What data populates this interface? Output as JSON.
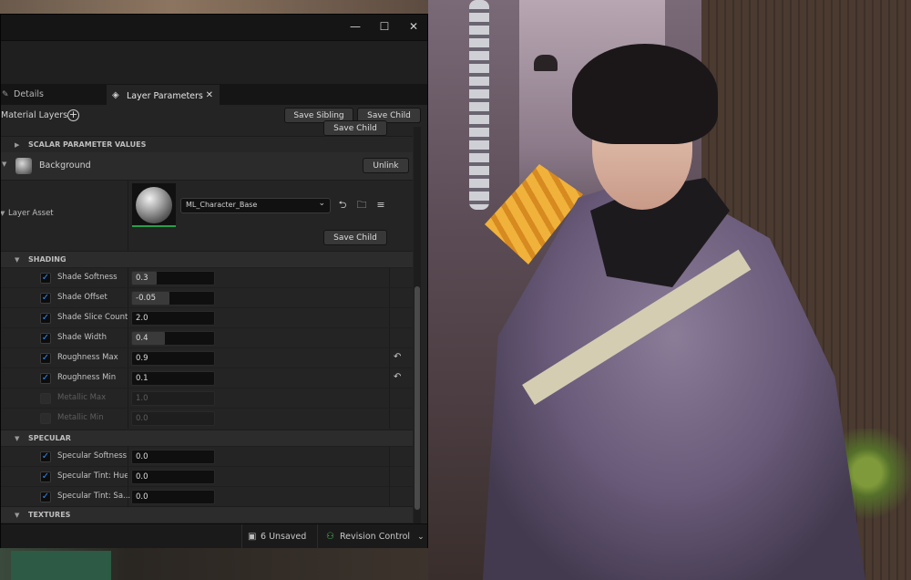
{
  "window": {
    "controls": {
      "minimize": "—",
      "maximize": "☐",
      "close": "✕"
    }
  },
  "tabs": [
    {
      "label": "Details",
      "icon": "pencil-icon"
    },
    {
      "label": "Layer Parameters",
      "icon": "layers-icon",
      "close": "✕"
    }
  ],
  "header": {
    "title": "Material Layers",
    "add_icon": "+",
    "save_sibling": "Save Sibling",
    "save_child": "Save Child"
  },
  "clipped_button": "Save Child",
  "scalar_section": "SCALAR PARAMETER VALUES",
  "layer": {
    "name": "Background",
    "unlink": "Unlink",
    "asset_label": "Layer Asset",
    "asset_value": "ML_Character_Base",
    "asset_caret": "⌄",
    "tools": {
      "use": "⮌",
      "browse": "🗀",
      "filter": "≡"
    },
    "save_child": "Save Child"
  },
  "shading": {
    "title": "SHADING",
    "params": [
      {
        "name": "Shade Softness",
        "value": "0.3",
        "checked": true,
        "fill": 0.3,
        "reset": false,
        "enabled": true
      },
      {
        "name": "Shade Offset",
        "value": "-0.05",
        "checked": true,
        "fill": 0.45,
        "reset": false,
        "enabled": true
      },
      {
        "name": "Shade Slice Count",
        "value": "2.0",
        "checked": true,
        "fill": 0,
        "reset": false,
        "enabled": true
      },
      {
        "name": "Shade Width",
        "value": "0.4",
        "checked": true,
        "fill": 0.4,
        "reset": false,
        "enabled": true
      },
      {
        "name": "Roughness Max",
        "value": "0.9",
        "checked": true,
        "fill": 0,
        "reset": true,
        "enabled": true
      },
      {
        "name": "Roughness Min",
        "value": "0.1",
        "checked": true,
        "fill": 0,
        "reset": true,
        "enabled": true
      },
      {
        "name": "Metallic Max",
        "value": "1.0",
        "checked": false,
        "fill": 0,
        "reset": false,
        "enabled": false
      },
      {
        "name": "Metallic Min",
        "value": "0.0",
        "checked": false,
        "fill": 0,
        "reset": false,
        "enabled": false
      }
    ]
  },
  "specular": {
    "title": "SPECULAR",
    "params": [
      {
        "name": "Specular Softness",
        "value": "0.0",
        "checked": true,
        "fill": 0,
        "reset": false,
        "enabled": true
      },
      {
        "name": "Specular Tint: Hue",
        "value": "0.0",
        "checked": true,
        "fill": 0,
        "reset": false,
        "enabled": true
      },
      {
        "name": "Specular Tint: Sa...",
        "value": "0.0",
        "checked": true,
        "fill": 0,
        "reset": false,
        "enabled": true
      }
    ]
  },
  "textures_section": "TEXTURES",
  "status": {
    "unsaved": "6 Unsaved",
    "revision_control": "Revision Control",
    "rc_caret": "⌄"
  },
  "colors": {
    "checkbox": "#2b8cf5",
    "thumbnail_underline": "#28a04a",
    "revision_icon": "#4fbf5a"
  }
}
